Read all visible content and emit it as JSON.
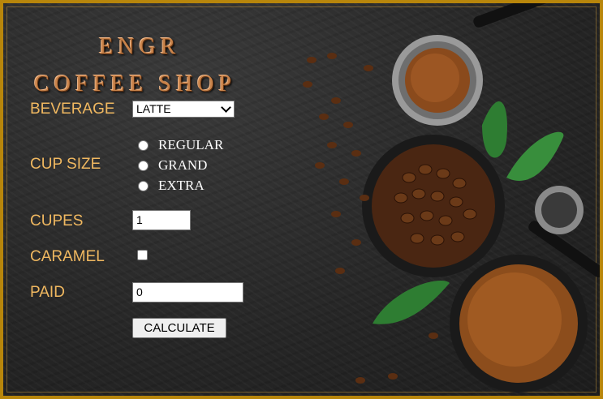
{
  "header": {
    "title_line1": "ENGR",
    "title_line2": "COFFEE SHOP"
  },
  "form": {
    "beverage": {
      "label": "BEVERAGE",
      "selected": "LATTE"
    },
    "cup_size": {
      "label": "CUP SIZE",
      "options": [
        "REGULAR",
        "GRAND",
        "EXTRA"
      ]
    },
    "cups": {
      "label": "CUPES",
      "value": "1"
    },
    "caramel": {
      "label": "CARAMEL",
      "checked": false
    },
    "paid": {
      "label": "PAID",
      "value": "0"
    },
    "calculate_label": "CALCULATE"
  },
  "colors": {
    "border": "#b8860b",
    "label": "#f0b860",
    "title": "#c9834a",
    "background": "#262626"
  }
}
